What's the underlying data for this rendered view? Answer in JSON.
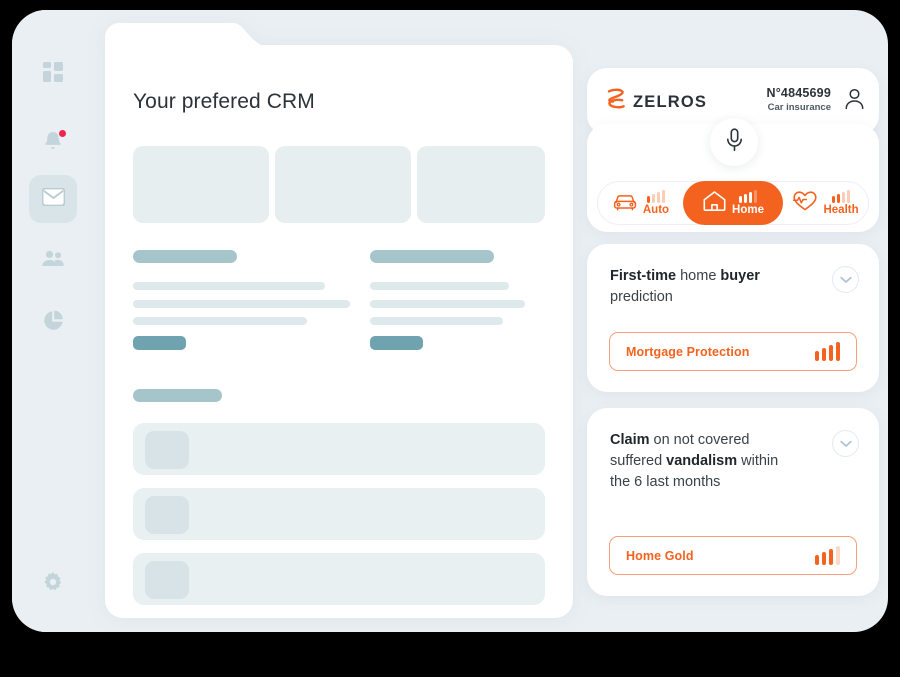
{
  "theme": {
    "accent": "#f4621f",
    "app_bg": "#eaeff3",
    "panel_bg": "#ffffff",
    "skeleton_head": "#a5c5cb",
    "skeleton_line": "#dde9ea",
    "skeleton_button": "#6fa3b0",
    "badge_red": "#f1224e"
  },
  "sidebar": {
    "items": [
      {
        "icon": "dashboard-grid-icon",
        "active": false,
        "badge": false
      },
      {
        "icon": "bell-icon",
        "active": false,
        "badge": true
      },
      {
        "icon": "mail-icon",
        "active": true,
        "badge": false
      },
      {
        "icon": "people-icon",
        "active": false,
        "badge": false
      },
      {
        "icon": "pie-chart-icon",
        "active": false,
        "badge": false
      }
    ],
    "footer": {
      "icon": "gear-icon"
    }
  },
  "crm": {
    "title": "Your prefered CRM"
  },
  "assistant": {
    "brand": "ZELROS",
    "brand_logo_icon": "zelros-z-logo",
    "policy_number": "N°4845699",
    "policy_type": "Car insurance",
    "account_icon": "user-avatar-icon",
    "mic_icon": "microphone-icon",
    "tabs": [
      {
        "label": "Auto",
        "icon": "car-icon",
        "active": false,
        "bars": [
          1,
          0,
          0,
          0
        ]
      },
      {
        "label": "Home",
        "icon": "house-icon",
        "active": true,
        "bars": [
          1,
          1,
          1,
          0
        ]
      },
      {
        "label": "Health",
        "icon": "heart-pulse-icon",
        "active": false,
        "bars": [
          1,
          1,
          0,
          0
        ]
      }
    ],
    "cards": [
      {
        "text_parts": [
          {
            "t": "First-time",
            "bold": true
          },
          {
            "t": " home ",
            "bold": false
          },
          {
            "t": "buyer",
            "bold": true
          },
          {
            "t": " prediction",
            "bold": false
          }
        ],
        "expand_icon": "chevron-down-icon",
        "product": {
          "label": "Mortgage Protection",
          "bars": [
            1,
            1,
            1,
            1
          ]
        }
      },
      {
        "text_parts": [
          {
            "t": "Claim",
            "bold": true
          },
          {
            "t": " on not covered suffered ",
            "bold": false
          },
          {
            "t": "vandalism",
            "bold": true
          },
          {
            "t": " within the 6 last months",
            "bold": false
          }
        ],
        "expand_icon": "chevron-down-icon",
        "product": {
          "label": "Home Gold",
          "bars": [
            1,
            1,
            1,
            0
          ]
        }
      }
    ]
  }
}
